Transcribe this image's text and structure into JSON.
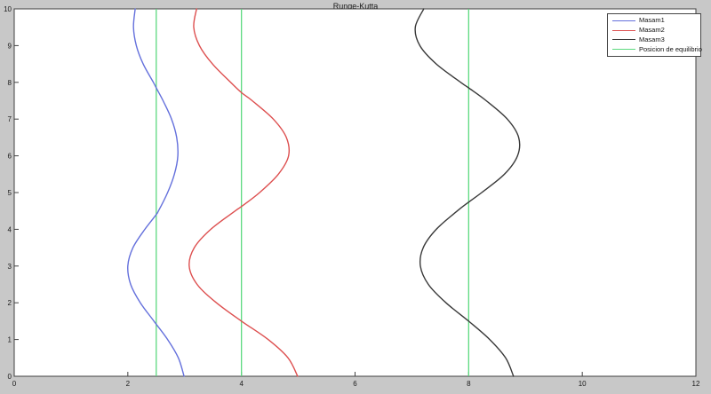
{
  "title": "Runge-Kutta",
  "colors": {
    "figure_bg": "#c8c8c8",
    "plot_bg": "#ffffff",
    "axis": "#404040",
    "tick_label": "#1a1a1a",
    "masam1": "#6470dc",
    "masam2": "#dd4f4f",
    "masam3": "#383838",
    "equilibrium": "#5cd97f"
  },
  "legend": {
    "items": [
      {
        "key": "masam1",
        "label": "Masam1",
        "color": "#6470dc"
      },
      {
        "key": "masam2",
        "label": "Masam2",
        "color": "#dd4f4f"
      },
      {
        "key": "masam3",
        "label": "Masam3",
        "color": "#383838"
      },
      {
        "key": "equilibrio",
        "label": "Posicion de equilibrio",
        "color": "#5cd97f"
      }
    ]
  },
  "chart_data": {
    "type": "line",
    "title": "Runge-Kutta",
    "xlabel": "",
    "ylabel": "",
    "xlim": [
      0,
      12
    ],
    "ylim": [
      0,
      10
    ],
    "x_ticks": [
      0,
      2,
      4,
      6,
      8,
      10,
      12
    ],
    "y_ticks": [
      0,
      1,
      2,
      3,
      4,
      5,
      6,
      7,
      8,
      9,
      10
    ],
    "grid": false,
    "legend_position": "upper right",
    "orientation": "position-x versus vertical time axis",
    "series": [
      {
        "name": "Masam1",
        "color": "#6470dc",
        "equilibrium": 2.5,
        "points": [
          [
            2.13,
            10
          ],
          [
            2.1,
            9.5
          ],
          [
            2.15,
            9
          ],
          [
            2.27,
            8.5
          ],
          [
            2.45,
            8
          ],
          [
            2.5,
            7.85
          ],
          [
            2.62,
            7.5
          ],
          [
            2.77,
            7
          ],
          [
            2.86,
            6.5
          ],
          [
            2.88,
            6
          ],
          [
            2.82,
            5.5
          ],
          [
            2.7,
            5
          ],
          [
            2.54,
            4.5
          ],
          [
            2.5,
            4.4
          ],
          [
            2.3,
            4
          ],
          [
            2.09,
            3.5
          ],
          [
            2.0,
            3
          ],
          [
            2.05,
            2.5
          ],
          [
            2.22,
            2
          ],
          [
            2.46,
            1.5
          ],
          [
            2.7,
            1
          ],
          [
            2.89,
            0.5
          ],
          [
            2.99,
            0
          ]
        ]
      },
      {
        "name": "Masam2",
        "color": "#dd4f4f",
        "equilibrium": 4,
        "points": [
          [
            3.21,
            10
          ],
          [
            3.16,
            9.5
          ],
          [
            3.26,
            9
          ],
          [
            3.49,
            8.5
          ],
          [
            3.81,
            8
          ],
          [
            4.0,
            7.72
          ],
          [
            4.19,
            7.5
          ],
          [
            4.56,
            7
          ],
          [
            4.79,
            6.5
          ],
          [
            4.83,
            6
          ],
          [
            4.65,
            5.5
          ],
          [
            4.32,
            5
          ],
          [
            4.0,
            4.62
          ],
          [
            3.89,
            4.5
          ],
          [
            3.46,
            4
          ],
          [
            3.17,
            3.5
          ],
          [
            3.08,
            3
          ],
          [
            3.22,
            2.5
          ],
          [
            3.56,
            2
          ],
          [
            4.0,
            1.5
          ],
          [
            4.47,
            1
          ],
          [
            4.82,
            0.5
          ],
          [
            4.99,
            0
          ]
        ]
      },
      {
        "name": "Masam3",
        "color": "#383838",
        "equilibrium": 8,
        "points": [
          [
            7.21,
            10
          ],
          [
            7.06,
            9.5
          ],
          [
            7.14,
            9
          ],
          [
            7.43,
            8.5
          ],
          [
            7.86,
            8
          ],
          [
            8.0,
            7.85
          ],
          [
            8.31,
            7.5
          ],
          [
            8.68,
            7
          ],
          [
            8.88,
            6.5
          ],
          [
            8.86,
            6
          ],
          [
            8.63,
            5.5
          ],
          [
            8.23,
            5
          ],
          [
            8.0,
            4.74
          ],
          [
            7.8,
            4.5
          ],
          [
            7.43,
            4
          ],
          [
            7.2,
            3.5
          ],
          [
            7.15,
            3
          ],
          [
            7.29,
            2.5
          ],
          [
            7.6,
            2
          ],
          [
            8.0,
            1.5
          ],
          [
            8.37,
            1
          ],
          [
            8.65,
            0.5
          ],
          [
            8.79,
            0
          ]
        ]
      }
    ],
    "equilibrium_lines": {
      "name": "Posicion de equilibrio",
      "color": "#5cd97f",
      "x_values": [
        2.5,
        4,
        8
      ]
    }
  }
}
